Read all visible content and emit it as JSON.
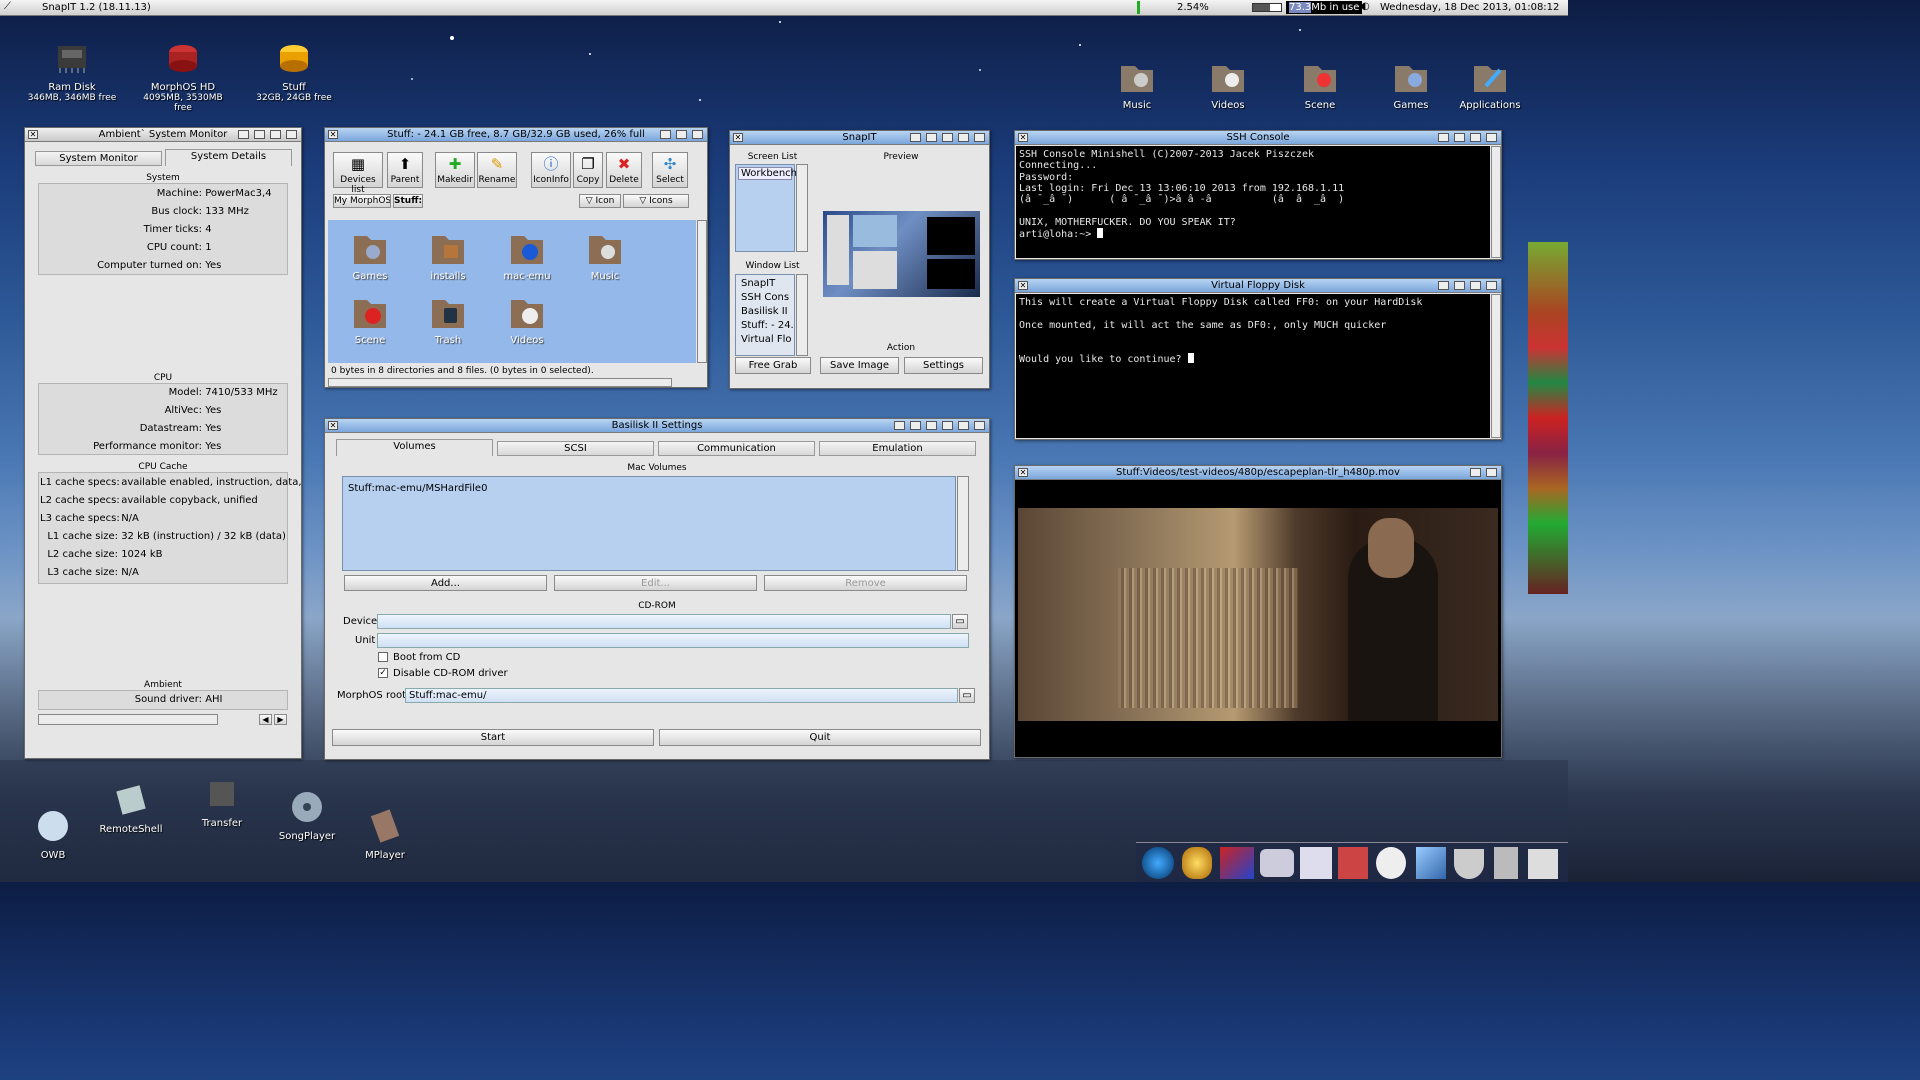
{
  "topbar": {
    "title": "SnapIT 1.2 (18.11.13)",
    "cpu": "2.54%",
    "mem_value": "73.3",
    "mem_label": "Mb in use",
    "datetime": "Wednesday, 18 Dec 2013, 01:08:12"
  },
  "desktop_icons": [
    {
      "name": "Ram Disk",
      "info": "346MB, 346MB free"
    },
    {
      "name": "MorphOS HD",
      "info": "4095MB, 3530MB free"
    },
    {
      "name": "Stuff",
      "info": "32GB, 24GB free"
    }
  ],
  "right_icons": [
    "Music",
    "Videos",
    "Scene",
    "Games",
    "Applications"
  ],
  "bottom_icons": [
    "OWB",
    "RemoteShell",
    "Transfer",
    "SongPlayer",
    "MPlayer"
  ],
  "sysmon": {
    "title": "Ambient` System Monitor",
    "tabs": [
      "System Monitor",
      "System Details"
    ],
    "system_label": "System",
    "system": [
      [
        "Machine:",
        "PowerMac3,4"
      ],
      [
        "Bus clock:",
        "133 MHz"
      ],
      [
        "Timer ticks:",
        "4"
      ],
      [
        "CPU count:",
        "1"
      ],
      [
        "Computer turned on:",
        "Yes"
      ]
    ],
    "cpu_label": "CPU",
    "cpu": [
      [
        "Model:",
        "7410/533 MHz"
      ],
      [
        "AltiVec:",
        "Yes"
      ],
      [
        "Datastream:",
        "Yes"
      ],
      [
        "Performance monitor:",
        "Yes"
      ]
    ],
    "cache_label": "CPU Cache",
    "cache": [
      [
        "L1 cache specs:",
        "available enabled, instruction, data,"
      ],
      [
        "L2 cache specs:",
        "available copyback, unified"
      ],
      [
        "L3 cache specs:",
        "N/A"
      ],
      [
        "L1 cache size:",
        "32 kB (instruction) / 32 kB (data)"
      ],
      [
        "L2 cache size:",
        "1024 kB"
      ],
      [
        "L3 cache size:",
        "N/A"
      ]
    ],
    "ambient_label": "Ambient",
    "sound_label": "Sound driver:",
    "sound": "AHI"
  },
  "stuff": {
    "title": "Stuff: - 24.1 GB free, 8.7 GB/32.9 GB used, 26% full",
    "toolbar": [
      "Devices list",
      "Parent",
      "Makedir",
      "Rename",
      "IconInfo",
      "Copy",
      "Delete",
      "Select"
    ],
    "path": [
      "My MorphOS",
      "Stuff:"
    ],
    "view": [
      "Icon",
      "Icons"
    ],
    "icons": [
      "Games",
      "installs",
      "mac-emu",
      "Music",
      "Scene",
      "Trash",
      "Videos"
    ],
    "status": "0 bytes in 8 directories and 8 files. (0 bytes in 0 selected)."
  },
  "snapit": {
    "title": "SnapIT",
    "screen_list_label": "Screen List",
    "screens": [
      "Workbench"
    ],
    "window_list_label": "Window List",
    "windows": [
      "SnapIT",
      "SSH Cons",
      "Basilisk II",
      "Stuff: - 24.",
      "Virtual Flo"
    ],
    "preview_label": "Preview",
    "action_label": "Action",
    "buttons": [
      "Free Grab",
      "Save Image",
      "Settings"
    ]
  },
  "ssh": {
    "title": "SSH Console",
    "lines": [
      "SSH Console Minishell (C)2007-2013 Jacek Piszczek",
      "Connecting...",
      "Password:",
      "Last login: Fri Dec 13 13:06:10 2013 from 192.168.1.11",
      "(â ¯_â ¯)      ( â ¯_â ¯)>â â -â          (â  â  _â  )",
      "",
      "UNIX, MOTHERFUCKER. DO YOU SPEAK IT?"
    ],
    "prompt": "arti@loha:~> "
  },
  "floppy": {
    "title": "Virtual Floppy Disk",
    "lines": [
      "This will create a Virtual Floppy Disk called FF0: on your HardDisk",
      "",
      "Once mounted, it will act the same as DF0:, only MUCH quicker",
      "",
      "",
      ""
    ],
    "prompt": "Would you like to continue? "
  },
  "basilisk": {
    "title": "Basilisk II Settings",
    "tabs": [
      "Volumes",
      "SCSI",
      "Communication",
      "Emulation"
    ],
    "mac_volumes_label": "Mac Volumes",
    "volumes": [
      "Stuff:mac-emu/MSHardFile0"
    ],
    "add": "Add...",
    "edit": "Edit...",
    "remove": "Remove",
    "cdrom_label": "CD-ROM",
    "device_label": "Device",
    "unit_label": "Unit",
    "boot_cd": "Boot from CD",
    "disable_cd": "Disable CD-ROM driver",
    "root_label": "MorphOS root",
    "root_value": "Stuff:mac-emu/",
    "start": "Start",
    "quit": "Quit"
  },
  "video": {
    "title": "Stuff:Videos/test-videos/480p/escapeplan-tlr_h480p.mov"
  }
}
